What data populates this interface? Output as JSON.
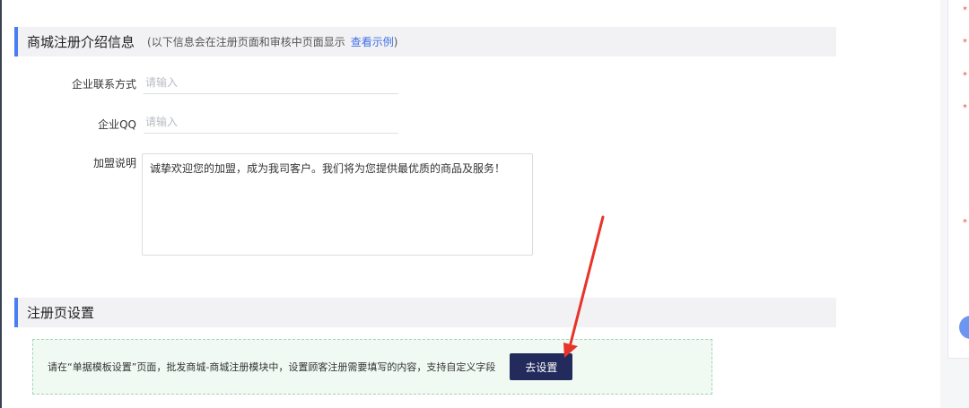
{
  "intro_section": {
    "title": "商城注册介绍信息",
    "hint_open": "(以下信息会在注册页面和审核中页面显示",
    "hint_link": "查看示例",
    "hint_close": ")"
  },
  "form": {
    "contact": {
      "label": "企业联系方式",
      "placeholder": "请输入",
      "value": ""
    },
    "qq": {
      "label": "企业QQ",
      "placeholder": "请输入",
      "value": ""
    },
    "join": {
      "label": "加盟说明",
      "value": "诚挚欢迎您的加盟，成为我司客户。我们将为您提供最优质的商品及服务！"
    }
  },
  "register_section": {
    "title": "注册页设置",
    "notice": "请在“单据模板设置”页面，批发商城-商城注册模块中，设置顾客注册需要填写的内容，支持自定义字段",
    "button_label": "去设置"
  },
  "right_panel": {
    "required_marks": [
      "*",
      "*",
      "*",
      "*",
      "*"
    ]
  },
  "colors": {
    "accent": "#4a7cf2",
    "link": "#3f6fe6",
    "button": "#232b5c",
    "annotation_arrow": "#e8332a",
    "notice_border": "#9fd6b4"
  }
}
